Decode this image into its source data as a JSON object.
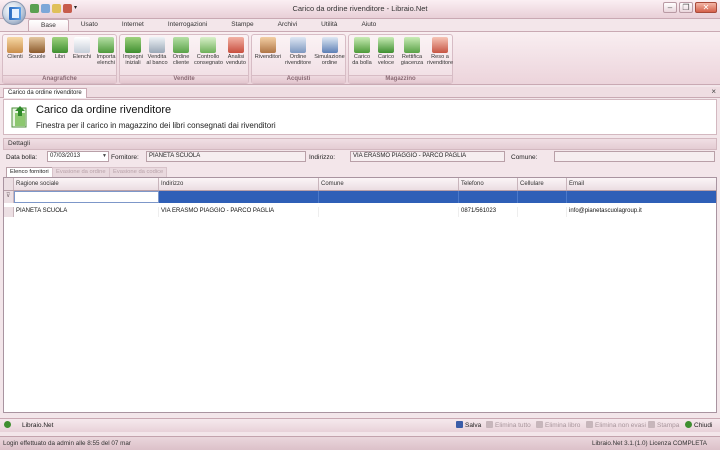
{
  "window": {
    "title": "Carico da ordine rivenditore - Libraio.Net"
  },
  "ribbon": {
    "tabs": [
      "Base",
      "Usato",
      "Internet",
      "Interrogazioni",
      "Stampe",
      "Archivi",
      "Utilità",
      "Aiuto"
    ],
    "active_tab": "Base",
    "groups": [
      {
        "label": "Anagrafiche",
        "buttons": [
          "Clienti",
          "Scuole",
          "Libri",
          "Elenchi",
          "Importa\nelenchi"
        ]
      },
      {
        "label": "Vendite",
        "buttons": [
          "Impegni\niniziali",
          "Vendita\nal banco",
          "Ordine\ncliente",
          "Controllo\nconsegnato",
          "Analisi\nvenduto"
        ]
      },
      {
        "label": "Acquisti",
        "buttons": [
          "Rivenditori",
          "Ordine\nrivenditore",
          "Simulazione\nordine"
        ]
      },
      {
        "label": "Magazzino",
        "buttons": [
          "Carico\nda bolla",
          "Carico\nveloce",
          "Rettifica\ngiacenza",
          "Reso a\nrivenditore"
        ]
      }
    ]
  },
  "doc_tab": {
    "label": "Carico da ordine rivenditore"
  },
  "header": {
    "title": "Carico da ordine rivenditore",
    "subtitle": "Finestra per il carico in magazzino dei libri consegnati dai rivenditori"
  },
  "details": {
    "section_label": "Dettagli",
    "data_bolla_label": "Data bolla:",
    "data_bolla_value": "07/03/2013",
    "fornitore_label": "Fornitore:",
    "fornitore_value": "PIANETA SCUOLA",
    "indirizzo_label": "Indirizzo:",
    "indirizzo_value": "VIA ERASMO PIAGGIO - PARCO PAGLIA",
    "comune_label": "Comune:",
    "comune_value": ""
  },
  "subtabs": [
    "Elenco fornitori",
    "Evasione da ordine",
    "Evasione da codice"
  ],
  "grid": {
    "columns": [
      "Ragione sociale",
      "Indirizzo",
      "Comune",
      "Telefono",
      "Cellulare",
      "Email"
    ],
    "rows": [
      [
        "PIANETA SCUOLA",
        "VIA ERASMO PIAGGIO - PARCO PAGLIA",
        "",
        "0871/561023",
        "",
        "info@pianetascuolagroup.it"
      ]
    ]
  },
  "footer": {
    "app_label": "Libraio.Net",
    "salva": "Salva",
    "elimina_tutto": "Elimina tutto",
    "elimina_libro": "Elimina libro",
    "elimina_non_evasi": "Elimina non evasi",
    "stampa": "Stampa",
    "chiudi": "Chiudi"
  },
  "status": {
    "left": "Login effettuato da admin alle 8:55 del 07 mar",
    "right": "Libraio.Net 3.1.(1.0) Licenza COMPLETA"
  },
  "colors": {
    "accent": "#2f5fb7",
    "chrome": "#ecd4db"
  }
}
